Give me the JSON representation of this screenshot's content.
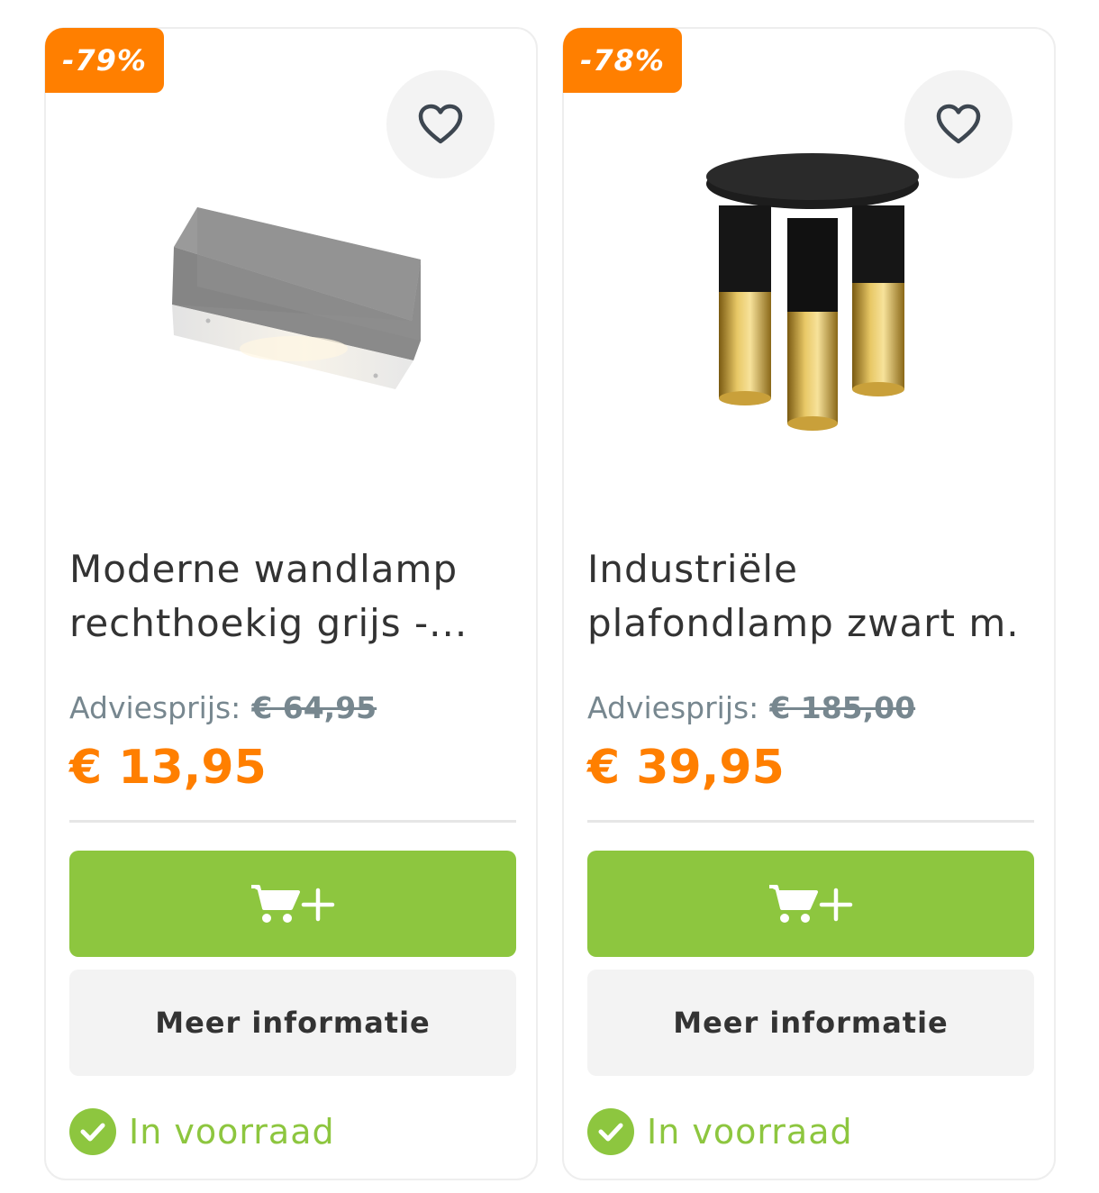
{
  "products": [
    {
      "discount": "-79%",
      "title_line1": "Moderne wandlamp",
      "title_line2": "rechthoekig grijs -...",
      "advies_label": "Adviesprijs:",
      "old_price": "€ 64,95",
      "price": "€ 13,95",
      "more_info": "Meer informatie",
      "stock": "In voorraad",
      "image": "grey-rectangular-wall-lamp"
    },
    {
      "discount": "-78%",
      "title_line1": "Industriële",
      "title_line2": "plafondlamp zwart m...",
      "advies_label": "Adviesprijs:",
      "old_price": "€ 185,00",
      "price": "€ 39,95",
      "more_info": "Meer informatie",
      "stock": "In voorraad",
      "image": "black-gold-ceiling-lamp"
    }
  ],
  "icons": {
    "favorite": "heart-outline-icon",
    "add_to_cart": "cart-plus-icon",
    "in_stock": "check-circle-icon"
  },
  "colors": {
    "accent": "#ff7f00",
    "primary_button": "#8dc63f",
    "stock_green": "#8dc63f",
    "muted_text": "#77878f"
  }
}
